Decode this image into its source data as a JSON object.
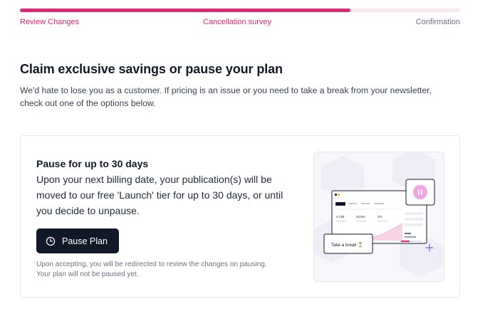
{
  "progress": {
    "fraction": 0.75
  },
  "steps": [
    {
      "label": "Review Changes",
      "state": "done"
    },
    {
      "label": "Cancellation survey",
      "state": "current"
    },
    {
      "label": "Confirmation",
      "state": "upcoming"
    }
  ],
  "header": {
    "title": "Claim exclusive savings or pause your plan",
    "description": "We'd hate to lose you as a customer. If pricing is an issue or you need to take a break from your newsletter, check out one of the options below."
  },
  "pause_card": {
    "title": "Pause for up to 30 days",
    "description": "Upon your next billing date, your publication(s) will be moved to our free 'Launch' tier for up to 30 days, or until you decide to unpause.",
    "button_label": "Pause Plan",
    "button_icon": "clock-icon",
    "note": "Upon accepting, you will be redirected to review the changes on pausing. Your plan will not be paused yet.",
    "illustration": {
      "tabs": [
        "",
        "",
        "",
        ""
      ],
      "stats": [
        "4,726",
        "42.8%",
        "2%"
      ],
      "badge_text": "Take a break ⏳",
      "icons": [
        "pause-icon",
        "sparkle-icon"
      ]
    }
  },
  "colors": {
    "accent": "#db2777",
    "accent_light": "#fce7f1",
    "button_bg": "#111827",
    "muted_text": "#6b7280"
  }
}
